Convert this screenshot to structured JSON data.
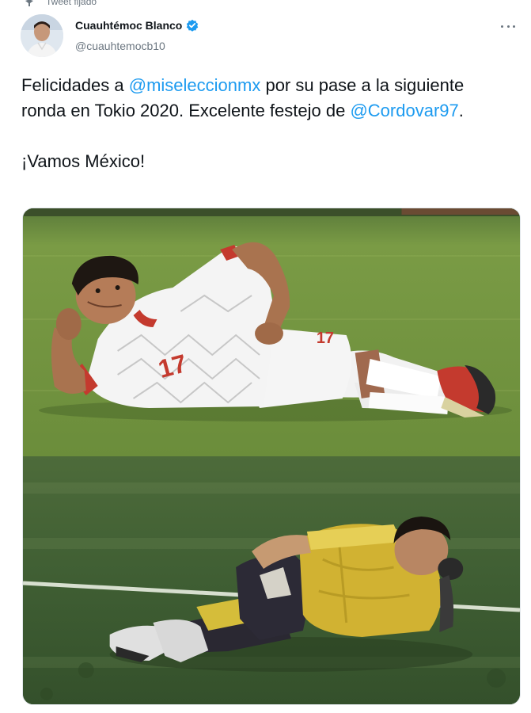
{
  "pinned": {
    "label": "Tweet fijado",
    "icon": "pin-icon"
  },
  "author": {
    "name": "Cuauhtémoc Blanco",
    "handle": "@cuauhtemocb10",
    "avatar_icon": "avatar",
    "verified_icon": "verified-badge-icon",
    "verified_color": "#1d9bf0"
  },
  "tweet": {
    "line1_pre": "Felicidades a ",
    "mention1": "@miseleccionmx",
    "line1_post": " por su pase a la siguiente ronda en Tokio 2020. Excelente festejo de ",
    "mention2": "@Cordovar97",
    "line1_end": ".",
    "line2": "¡Vamos México!"
  },
  "media": {
    "photo_top": {
      "jersey_number": "17",
      "shorts_number": "17"
    },
    "photo_bottom": {}
  },
  "colors": {
    "link": "#1d9bf0",
    "text": "#0f1419",
    "muted": "#6b7680"
  }
}
